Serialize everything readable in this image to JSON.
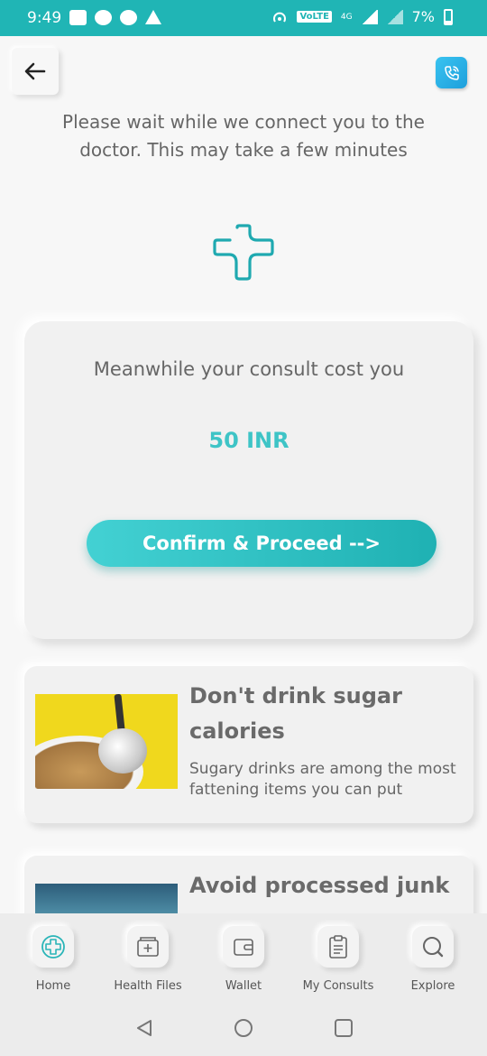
{
  "status_bar": {
    "time": "9:49",
    "network_label": "VoLTE",
    "network_type": "4G",
    "battery": "7%"
  },
  "header": {
    "back_icon": "back-arrow-icon",
    "call_icon": "video-call-icon"
  },
  "waiting": {
    "message": "Please wait while we connect you to the doctor. This may take a few minutes",
    "icon": "medical-cross-icon"
  },
  "cost_card": {
    "text": "Meanwhile your consult cost you",
    "amount": "50 INR",
    "button_label": "Confirm & Proceed -->"
  },
  "articles": [
    {
      "title": "Don't drink sugar calories",
      "description": "Sugary drinks are among the most fattening items you can put"
    },
    {
      "title": "Avoid processed junk"
    }
  ],
  "bottom_nav": {
    "items": [
      {
        "label": "Home",
        "icon": "plus-circle-icon"
      },
      {
        "label": "Health Files",
        "icon": "health-files-icon"
      },
      {
        "label": "Wallet",
        "icon": "wallet-icon"
      },
      {
        "label": "My Consults",
        "icon": "clipboard-icon"
      },
      {
        "label": "Explore",
        "icon": "search-icon"
      }
    ]
  },
  "colors": {
    "accent": "#20b5b5",
    "price": "#3ec4c6",
    "call_button": "#2aaee8"
  }
}
